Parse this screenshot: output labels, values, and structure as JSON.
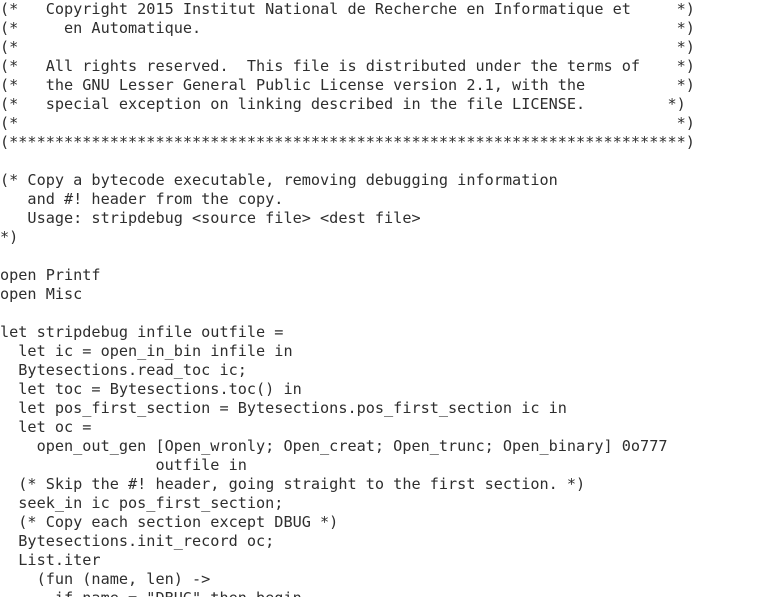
{
  "document": {
    "lines": [
      "(*   Copyright 2015 Institut National de Recherche en Informatique et     *)",
      "(*     en Automatique.                                                    *)",
      "(*                                                                        *)",
      "(*   All rights reserved.  This file is distributed under the terms of    *)",
      "(*   the GNU Lesser General Public License version 2.1, with the          *)",
      "(*   special exception on linking described in the file LICENSE.         *)",
      "(*                                                                        *)",
      "(**************************************************************************)",
      "",
      "(* Copy a bytecode executable, removing debugging information",
      "   and #! header from the copy.",
      "   Usage: stripdebug <source file> <dest file>",
      "*)",
      "",
      "open Printf",
      "open Misc",
      "",
      "let stripdebug infile outfile =",
      "  let ic = open_in_bin infile in",
      "  Bytesections.read_toc ic;",
      "  let toc = Bytesections.toc() in",
      "  let pos_first_section = Bytesections.pos_first_section ic in",
      "  let oc =",
      "    open_out_gen [Open_wronly; Open_creat; Open_trunc; Open_binary] 0o777",
      "                 outfile in",
      "  (* Skip the #! header, going straight to the first section. *)",
      "  seek_in ic pos_first_section;",
      "  (* Copy each section except DBUG *)",
      "  Bytesections.init_record oc;",
      "  List.iter",
      "    (fun (name, len) ->",
      "      if name = \"DBUG\" then begin"
    ]
  }
}
